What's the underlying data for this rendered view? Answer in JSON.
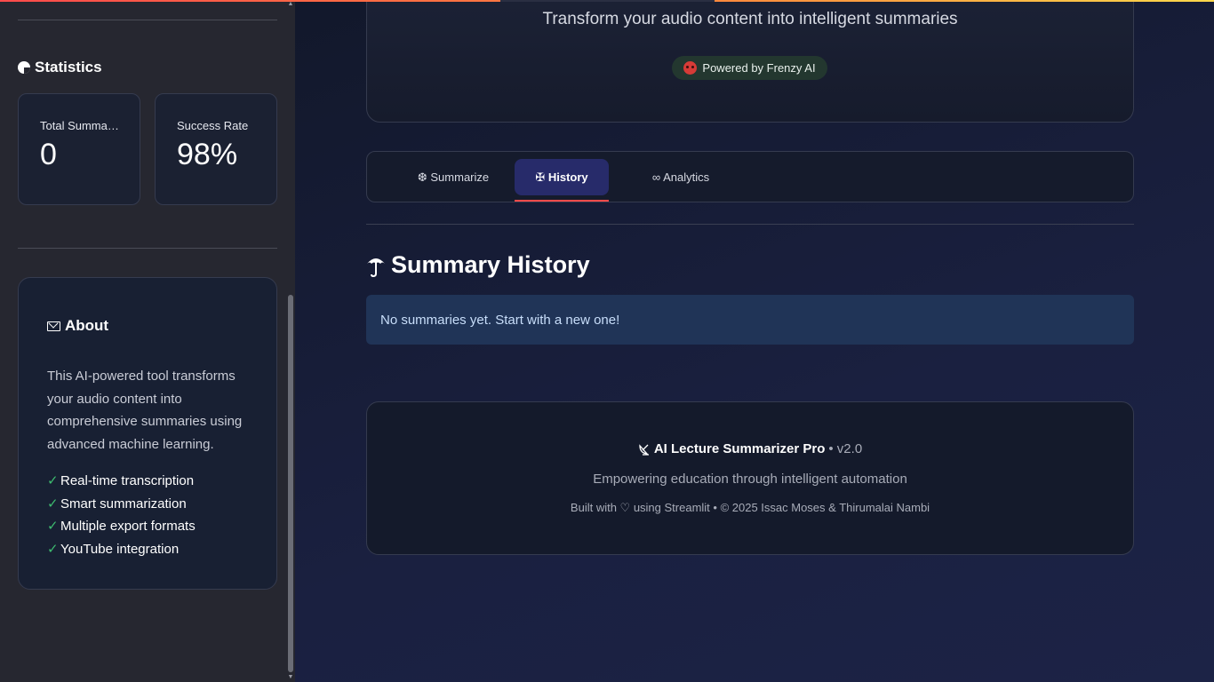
{
  "sidebar": {
    "statistics_title": "Statistics",
    "stats": [
      {
        "label": "Total Summaries",
        "value": "0"
      },
      {
        "label": "Success Rate",
        "value": "98%"
      }
    ],
    "about": {
      "title": "About",
      "description": "This AI-powered tool transforms your audio content into comprehensive summaries using advanced machine learning.",
      "features": [
        "Real-time transcription",
        "Smart summarization",
        "Multiple export formats",
        "YouTube integration"
      ]
    }
  },
  "hero": {
    "subtitle": "Transform your audio content into intelligent summaries",
    "badge": "Powered by Frenzy AI"
  },
  "tabs": [
    {
      "label": "❆ Summarize",
      "active": false
    },
    {
      "label": "✠ History",
      "active": true
    },
    {
      "label": "∞ Analytics",
      "active": false
    }
  ],
  "history": {
    "title": "Summary History",
    "empty_message": "No summaries yet. Start with a new one!"
  },
  "footer": {
    "app_name": "AI Lecture Summarizer Pro",
    "version": "• v2.0",
    "tagline": "Empowering education through intelligent automation",
    "credits": "Built with ♡ using Streamlit • © 2025 Issac Moses & Thirumalai Nambi"
  },
  "colors": {
    "accent": "#ff4b4b",
    "active_tab": "#272b6a",
    "info_bg": "#203457",
    "check": "#3dbb6f"
  }
}
